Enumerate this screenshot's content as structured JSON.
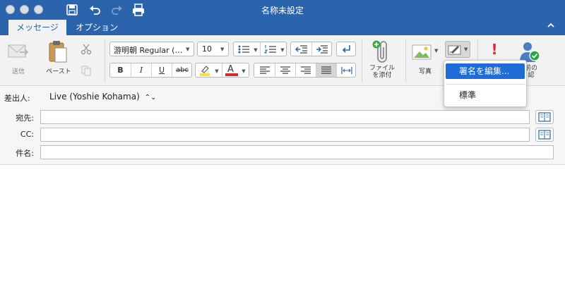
{
  "window": {
    "title": "名称未設定",
    "quick_access": [
      "save-icon",
      "undo-icon",
      "redo-icon",
      "print-icon"
    ]
  },
  "ribbon_tabs": [
    {
      "label": "メッセージ",
      "active": true
    },
    {
      "label": "オプション",
      "active": false
    }
  ],
  "ribbon": {
    "send_label": "送信",
    "paste_label": "ペースト",
    "font_name": "游明朝 Regular (…",
    "font_size": "10",
    "bold": "B",
    "italic": "I",
    "underline": "U",
    "strikethrough": "abc",
    "text_color_letter": "A",
    "attach_label_line1": "ファイル",
    "attach_label_line2": "を添付",
    "photo_label": "写真",
    "importance_icon": "!",
    "check_names_line1": "前の",
    "check_names_line2": "認"
  },
  "signature_menu": {
    "items": [
      {
        "label": "署名を編集...",
        "highlighted": true
      },
      {
        "label": "標準",
        "highlighted": false
      }
    ]
  },
  "header_fields": {
    "from_label": "差出人:",
    "from_value": "Live (Yoshie Kohama)",
    "to_label": "宛先:",
    "cc_label": "CC:",
    "subject_label": "件名:",
    "to_value": "",
    "cc_value": "",
    "subject_value": ""
  },
  "colors": {
    "titlebar": "#2b64ad",
    "menu_highlight": "#1f6bd8",
    "highlight_swatch": "#f5e13a",
    "font_color_swatch": "#d62b2b",
    "importance": "#e0282b",
    "check_green": "#28a745"
  }
}
